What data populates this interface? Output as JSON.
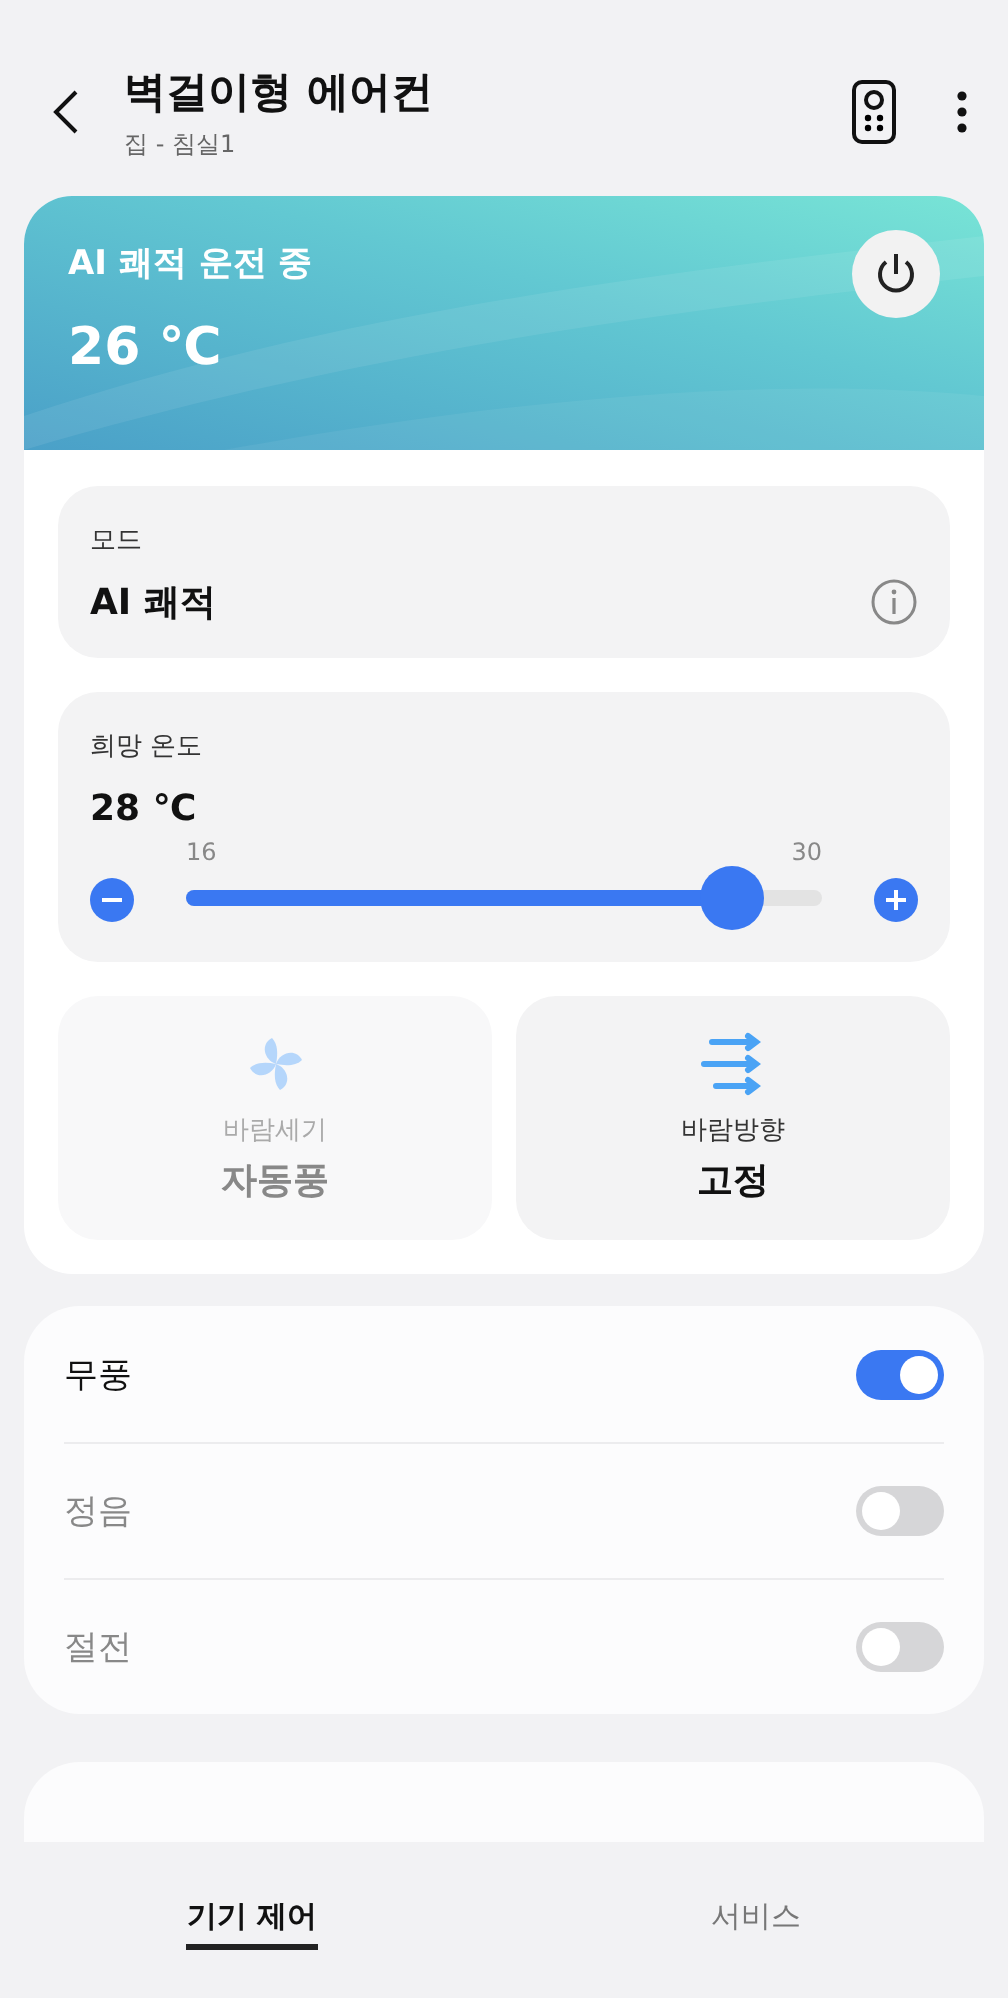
{
  "header": {
    "title": "벽걸이형 에어컨",
    "subtitle": "집 - 침실1"
  },
  "status": {
    "label": "AI 쾌적 운전 중",
    "temperature": "26 ℃",
    "power_on": true
  },
  "mode": {
    "label": "모드",
    "value": "AI 쾌적"
  },
  "target": {
    "label": "희망 온도",
    "value": "28 ℃",
    "min": "16",
    "max": "30",
    "level": 0.857
  },
  "tiles": [
    {
      "kind": "fan",
      "label": "바람세기",
      "value": "자동풍",
      "disabled": true
    },
    {
      "kind": "direction",
      "label": "바람방향",
      "value": "고정",
      "disabled": false
    }
  ],
  "toggles": [
    {
      "label": "무풍",
      "on": true
    },
    {
      "label": "정음",
      "on": false
    },
    {
      "label": "절전",
      "on": false
    }
  ],
  "tabs": [
    {
      "label": "기기 제어",
      "selected": true
    },
    {
      "label": "서비스",
      "selected": false
    }
  ]
}
